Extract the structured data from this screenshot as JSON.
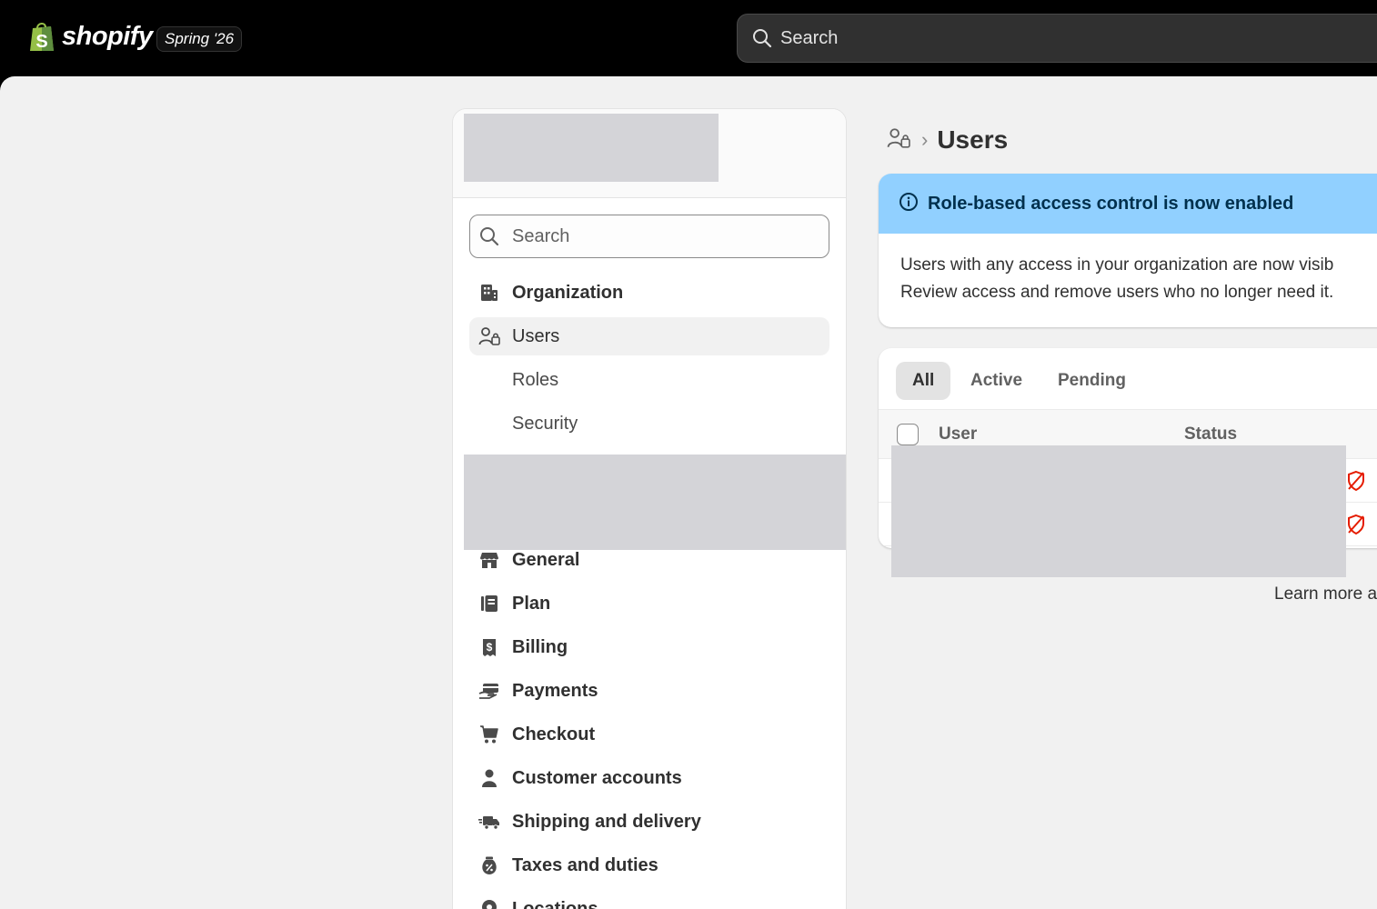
{
  "brand": {
    "name": "shopify",
    "edition": "Spring '26"
  },
  "topbar": {
    "search_placeholder": "Search"
  },
  "sidebar": {
    "search_placeholder": "Search",
    "items": [
      {
        "label": "Organization",
        "icon": "building-icon"
      },
      {
        "label": "Users",
        "icon": "users-icon",
        "active": true
      },
      {
        "label": "Roles"
      },
      {
        "label": "Security"
      },
      {
        "label": "General",
        "icon": "store-icon"
      },
      {
        "label": "Plan",
        "icon": "plan-icon"
      },
      {
        "label": "Billing",
        "icon": "receipt-dollar-icon"
      },
      {
        "label": "Payments",
        "icon": "payments-icon"
      },
      {
        "label": "Checkout",
        "icon": "cart-icon"
      },
      {
        "label": "Customer accounts",
        "icon": "person-icon"
      },
      {
        "label": "Shipping and delivery",
        "icon": "truck-icon"
      },
      {
        "label": "Taxes and duties",
        "icon": "tax-bag-icon"
      },
      {
        "label": "Locations",
        "icon": "location-pin-icon"
      }
    ]
  },
  "page": {
    "title": "Users"
  },
  "banner": {
    "title": "Role-based access control is now enabled",
    "line1": "Users with any access in your organization are now visib",
    "line2": "Review access and remove users who no longer need it."
  },
  "table": {
    "tabs": [
      "All",
      "Active",
      "Pending"
    ],
    "headers": {
      "user": "User",
      "status": "Status"
    }
  },
  "footer": {
    "learn_more": "Learn more a"
  },
  "colors": {
    "banner_bg": "#91d0ff",
    "status_critical": "#e51c00"
  }
}
